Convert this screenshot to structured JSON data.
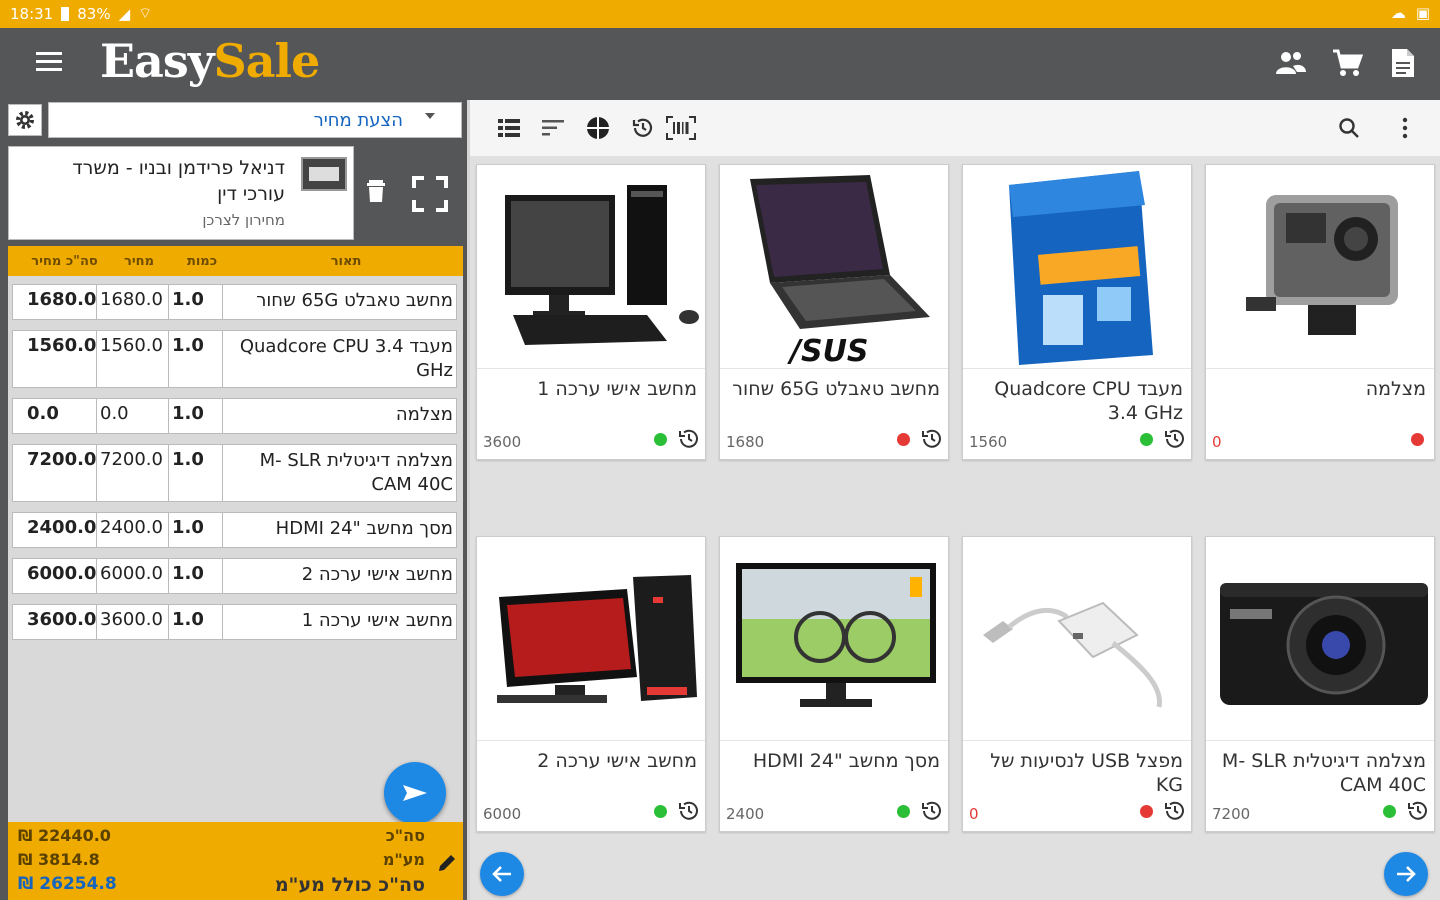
{
  "status_bar": {
    "time": "18:31",
    "battery": "83%"
  },
  "app": {
    "logo_part1": "Easy",
    "logo_part2": "Sale",
    "brand_color": "#f0ab00",
    "bar_color": "#555657"
  },
  "doc_type": {
    "selected": "הצעת מחיר"
  },
  "customer": {
    "name": "דניאל פרידמן ובניו - משרד עורכי דין",
    "subtitle": "מחירון לצרכן"
  },
  "table": {
    "headers": {
      "desc": "תאור",
      "qty": "כמות",
      "price": "מחיר",
      "total": "סה\"כ מחיר"
    },
    "rows": [
      {
        "desc": "מחשב טאבלט 65G שחור",
        "qty": "1.0",
        "price": "1680.0",
        "total": "1680.0"
      },
      {
        "desc": "מעבד Quadcore CPU 3.4 GHz",
        "qty": "1.0",
        "price": "1560.0",
        "total": "1560.0"
      },
      {
        "desc": "מצלמה",
        "qty": "1.0",
        "price": "0.0",
        "total": "0.0"
      },
      {
        "desc": "מצלמה דיגיטלית M- SLR CAM 40C",
        "qty": "1.0",
        "price": "7200.0",
        "total": "7200.0"
      },
      {
        "desc": "מסך מחשב \"24 HDMI",
        "qty": "1.0",
        "price": "2400.0",
        "total": "2400.0"
      },
      {
        "desc": "מחשב אישי ערכה 2",
        "qty": "1.0",
        "price": "6000.0",
        "total": "6000.0"
      },
      {
        "desc": "מחשב אישי ערכה 1",
        "qty": "1.0",
        "price": "3600.0",
        "total": "3600.0"
      }
    ]
  },
  "totals": {
    "subtotal_label": "סה\"כ",
    "subtotal": "₪ 22440.0",
    "vat_label": "מע\"מ",
    "vat": "₪ 3814.8",
    "grand_label": "סה\"כ כולל מע\"מ",
    "grand": "₪ 26254.8"
  },
  "products": [
    {
      "title": "מחשב אישי ערכה 1",
      "price": "3600",
      "stock": "green",
      "has_history": true
    },
    {
      "title": "מחשב טאבלט 65G שחור",
      "price": "1680",
      "stock": "red",
      "has_history": true
    },
    {
      "title": "מעבד Quadcore CPU 3.4 GHz",
      "price": "1560",
      "stock": "green",
      "has_history": true
    },
    {
      "title": "מצלמה",
      "price": "0",
      "stock": "red",
      "has_history": false
    },
    {
      "title": "מחשב אישי ערכה 2",
      "price": "6000",
      "stock": "green",
      "has_history": true
    },
    {
      "title": "מסך מחשב \"24 HDMI",
      "price": "2400",
      "stock": "green",
      "has_history": true
    },
    {
      "title": "מפצל USB לנסיעות של KG",
      "price": "0",
      "stock": "red",
      "has_history": true
    },
    {
      "title": "מצלמה דיגיטלית M- SLR CAM 40C",
      "price": "7200",
      "stock": "green",
      "has_history": true
    }
  ],
  "colors": {
    "in_stock": "#2bbf38",
    "out_of_stock": "#e53935",
    "accent_blue": "#1e88e5"
  }
}
